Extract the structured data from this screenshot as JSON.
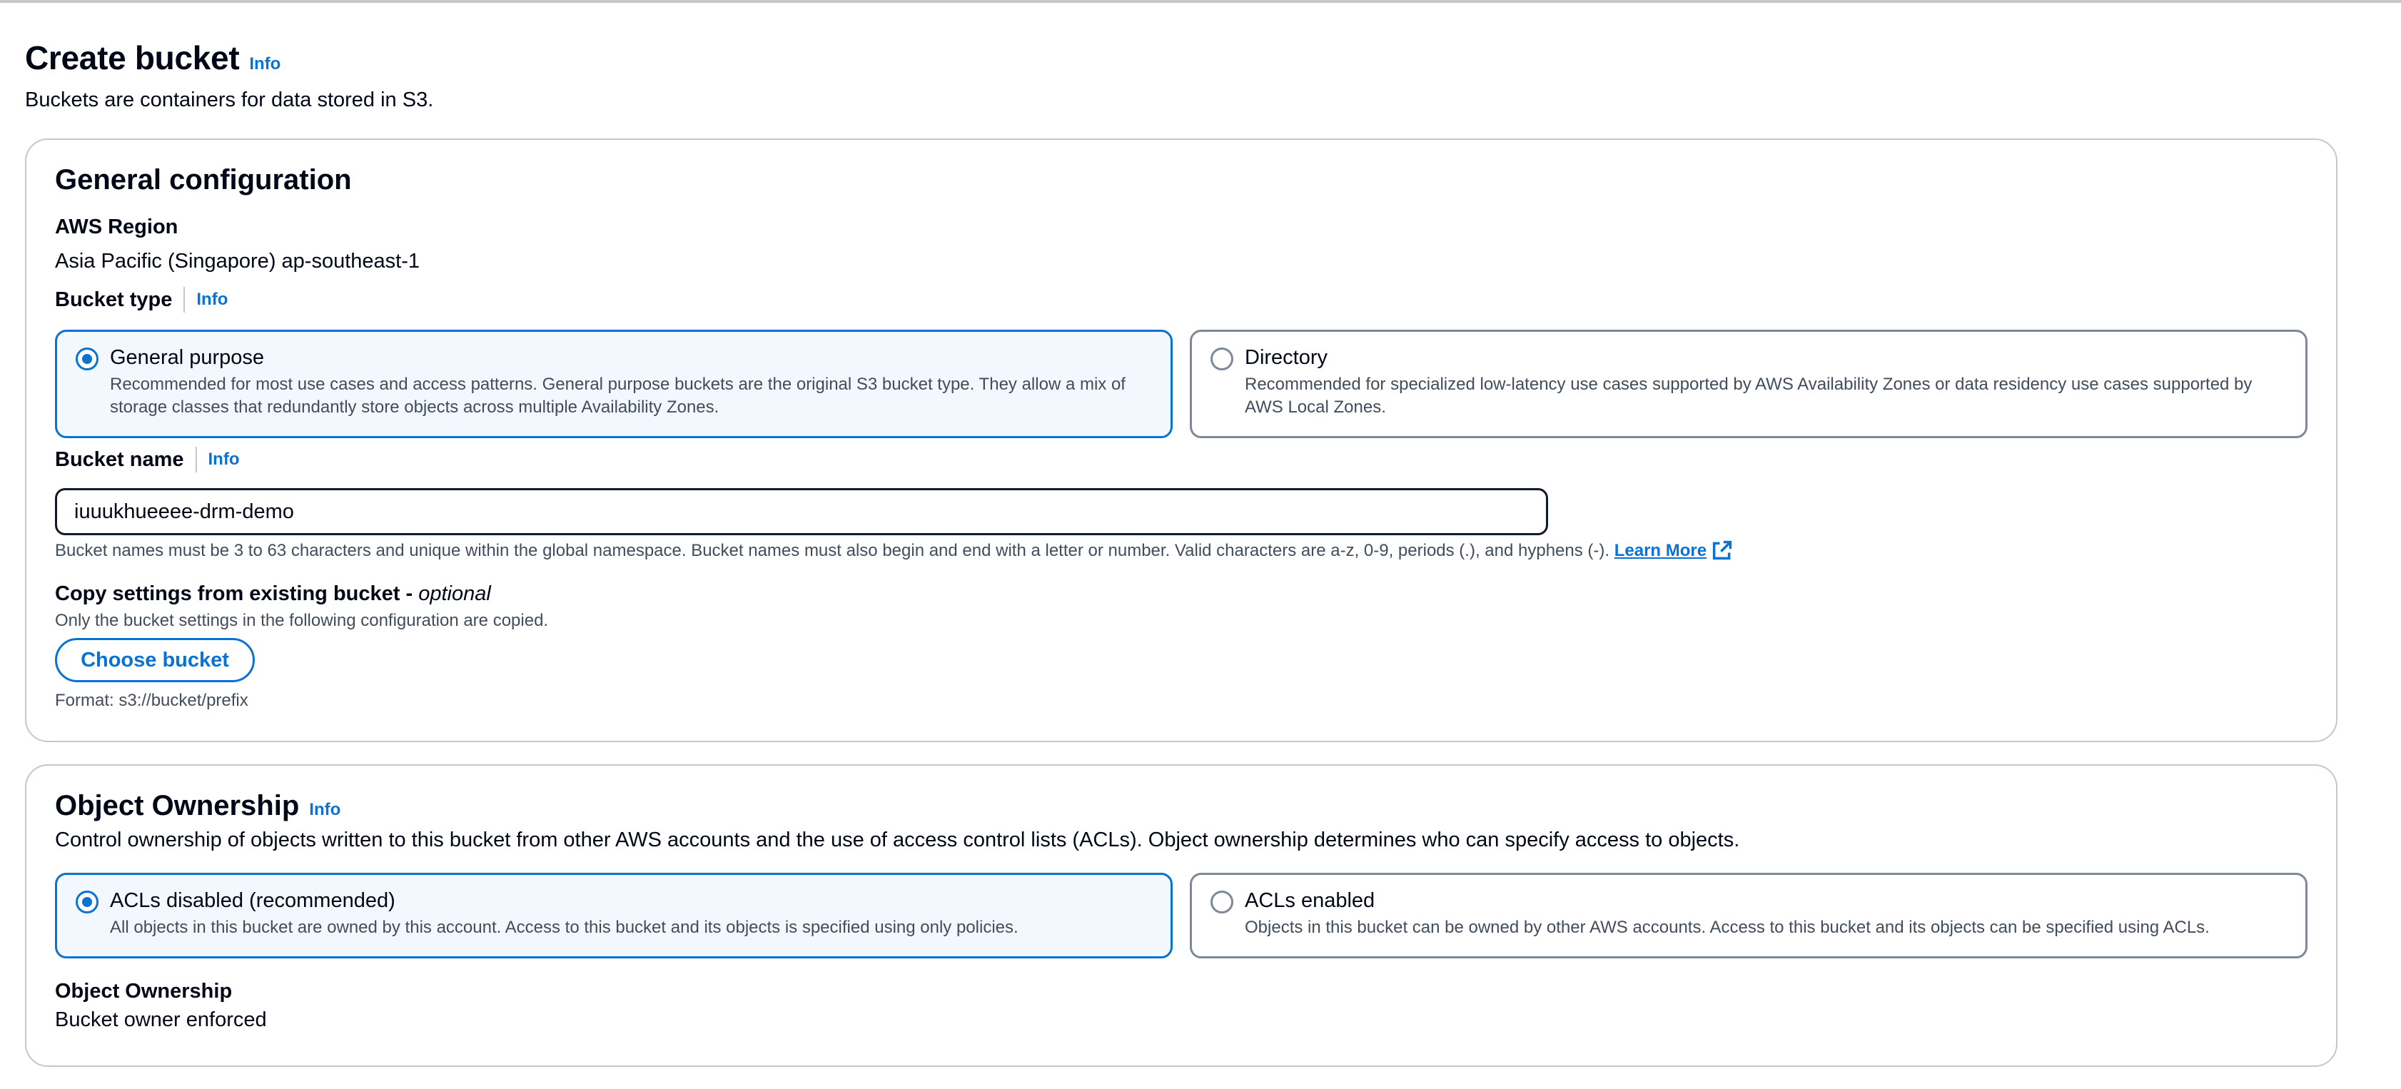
{
  "page": {
    "title": "Create bucket",
    "info": "Info",
    "description": "Buckets are containers for data stored in S3."
  },
  "general": {
    "heading": "General configuration",
    "region_label": "AWS Region",
    "region_value": "Asia Pacific (Singapore) ap-southeast-1",
    "bucket_type_label": "Bucket type",
    "bucket_type_info": "Info",
    "bucket_types": [
      {
        "title": "General purpose",
        "description": "Recommended for most use cases and access patterns. General purpose buckets are the original S3 bucket type. They allow a mix of storage classes that redundantly store objects across multiple Availability Zones.",
        "selected": true
      },
      {
        "title": "Directory",
        "description": "Recommended for specialized low-latency use cases supported by AWS Availability Zones or data residency use cases supported by AWS Local Zones.",
        "selected": false
      }
    ],
    "bucket_name_label": "Bucket name",
    "bucket_name_info": "Info",
    "bucket_name_value": "iuuukhueeee-drm-demo",
    "bucket_name_hint": "Bucket names must be 3 to 63 characters and unique within the global namespace. Bucket names must also begin and end with a letter or number. Valid characters are a-z, 0-9, periods (.), and hyphens (-).",
    "learn_more": "Learn More",
    "copy_label": "Copy settings from existing bucket -",
    "copy_optional": "optional",
    "copy_desc": "Only the bucket settings in the following configuration are copied.",
    "choose_button": "Choose bucket",
    "format_hint": "Format: s3://bucket/prefix"
  },
  "ownership": {
    "heading": "Object Ownership",
    "info": "Info",
    "description": "Control ownership of objects written to this bucket from other AWS accounts and the use of access control lists (ACLs). Object ownership determines who can specify access to objects.",
    "options": [
      {
        "title": "ACLs disabled (recommended)",
        "description": "All objects in this bucket are owned by this account. Access to this bucket and its objects is specified using only policies.",
        "selected": true
      },
      {
        "title": "ACLs enabled",
        "description": "Objects in this bucket can be owned by other AWS accounts. Access to this bucket and its objects can be specified using ACLs.",
        "selected": false
      }
    ],
    "result_label": "Object Ownership",
    "result_value": "Bucket owner enforced"
  },
  "icons": {
    "external": "external-link-icon"
  },
  "colors": {
    "accent": "#0972d3",
    "selected_bg": "#f2f8fd",
    "border": "#c6c6cd",
    "text": "#000716"
  }
}
